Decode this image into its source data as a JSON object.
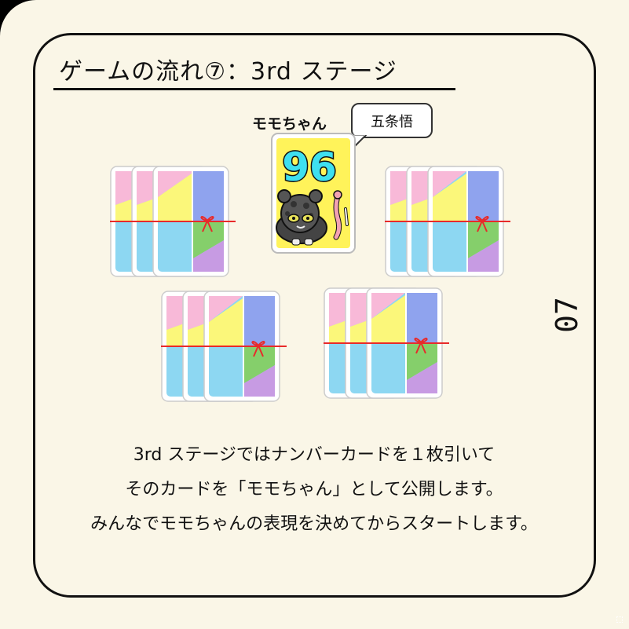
{
  "header": {
    "title": "ゲームの流れ⑦：3rd ステージ"
  },
  "center_card": {
    "owner_label": "モモちゃん",
    "number": "96",
    "speech_bubble": "五条悟",
    "card_color": "#fff35a",
    "number_color": "#3ee0f0"
  },
  "decks": [
    {
      "name": "deck-top-left"
    },
    {
      "name": "deck-top-right"
    },
    {
      "name": "deck-bottom-left"
    },
    {
      "name": "deck-bottom-right"
    }
  ],
  "card_back_colors": {
    "pink": "#f8b9d8",
    "yellow": "#fbf77a",
    "sky": "#8dd7f2",
    "blue": "#8fa3ee",
    "green": "#85cf6b",
    "purple": "#c79be3",
    "ribbon": "#e82a2a"
  },
  "page_number": "07",
  "body": {
    "line1": "3rd ステージではナンバーカードを１枚引いて",
    "line2": "そのカードを「モモちゃん」として公開します。",
    "line3": "みんなでモモちゃんの表現を決めてからスタートします。"
  }
}
